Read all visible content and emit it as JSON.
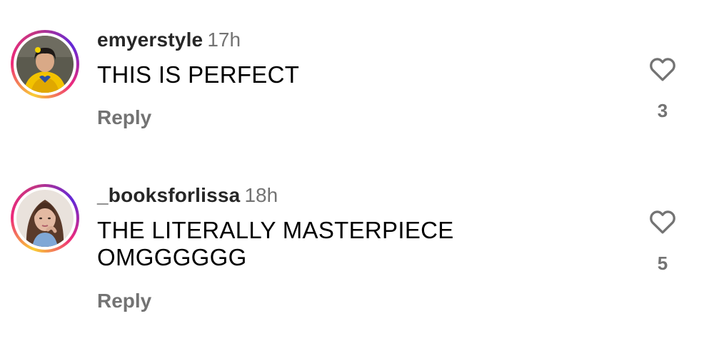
{
  "comments": [
    {
      "username": "emyerstyle",
      "time": "17h",
      "text_lines": [
        "THIS IS PERFECT"
      ],
      "reply_label": "Reply",
      "like_count": "3",
      "avatar_icon": "avatar-photo-icon",
      "heart_icon": "heart-outline-icon"
    },
    {
      "username": "_booksforlissa",
      "time": "18h",
      "text_lines": [
        "THE LITERALLY MASTERPIECE",
        "OMGGGGGG"
      ],
      "reply_label": "Reply",
      "like_count": "5",
      "avatar_icon": "avatar-photo-icon",
      "heart_icon": "heart-outline-icon"
    }
  ],
  "colors": {
    "text_primary": "#000000",
    "username": "#262626",
    "secondary": "#737373",
    "story_ring": [
      "#f9ce34",
      "#ee2a7b",
      "#6228d7"
    ]
  }
}
